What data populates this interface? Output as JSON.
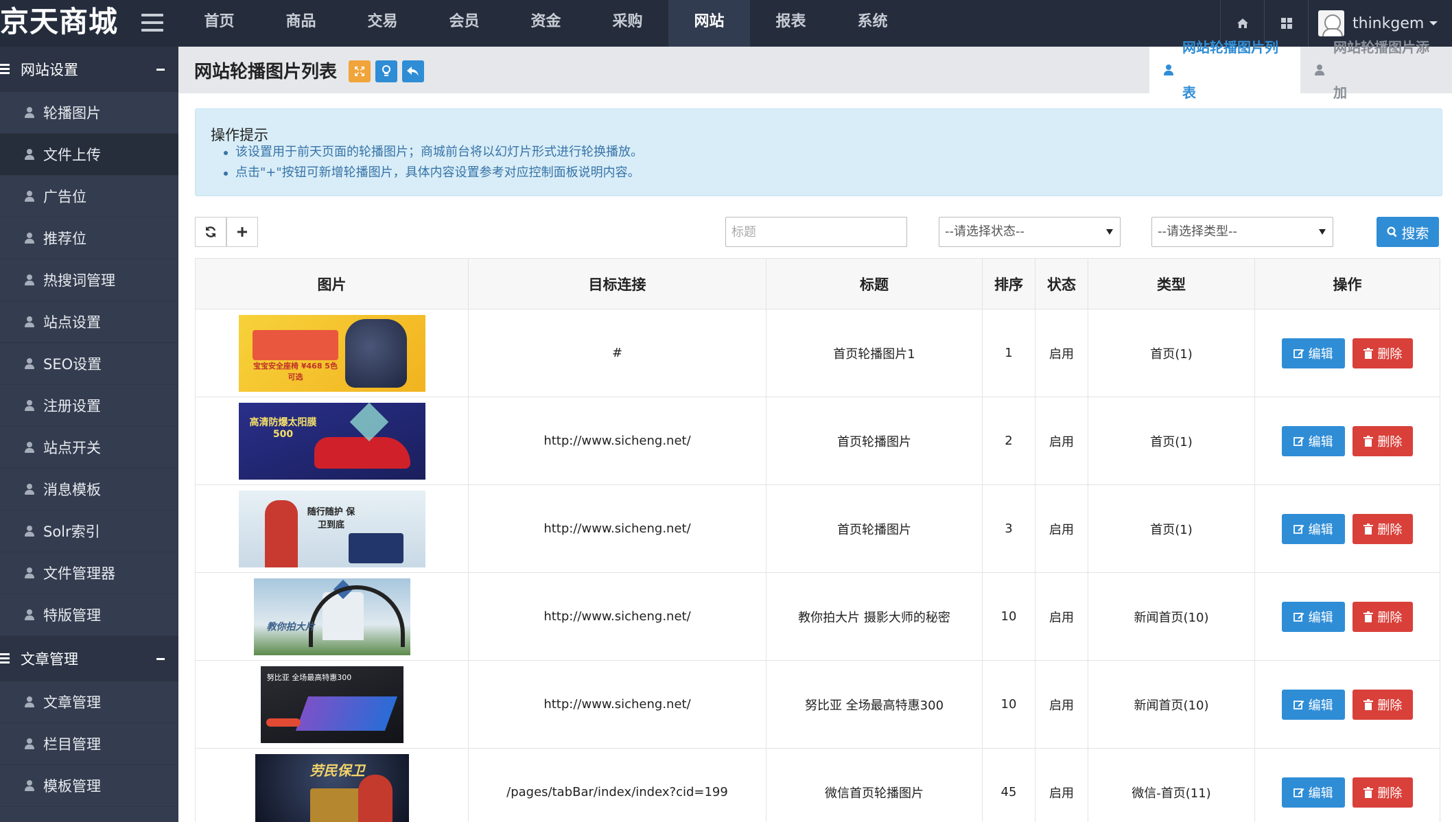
{
  "brand": "京天商城",
  "nav": [
    "首页",
    "商品",
    "交易",
    "会员",
    "资金",
    "采购",
    "网站",
    "报表",
    "系统"
  ],
  "nav_active_index": 6,
  "user": {
    "name": "thinkgem"
  },
  "sidebar": {
    "groups": [
      {
        "title": "网站设置",
        "items": [
          "轮播图片",
          "文件上传",
          "广告位",
          "推荐位",
          "热搜词管理",
          "站点设置",
          "SEO设置",
          "注册设置",
          "站点开关",
          "消息模板",
          "Solr索引",
          "文件管理器",
          "特版管理"
        ]
      },
      {
        "title": "文章管理",
        "items": [
          "文章管理",
          "栏目管理",
          "模板管理"
        ]
      }
    ],
    "active_item": "文件上传"
  },
  "page": {
    "title": "网站轮播图片列表",
    "tabs": [
      "网站轮播图片列表",
      "网站轮播图片添加"
    ]
  },
  "tips": {
    "title": "操作提示",
    "lines": [
      "该设置用于前天页面的轮播图片；商城前台将以幻灯片形式进行轮换播放。",
      "点击\"+\"按钮可新增轮播图片，具体内容设置参考对应控制面板说明内容。"
    ]
  },
  "filters": {
    "title_placeholder": "标题",
    "status_select": "--请选择状态--",
    "type_select": "--请选择类型--",
    "search_label": "搜索"
  },
  "table": {
    "headers": [
      "图片",
      "目标连接",
      "标题",
      "排序",
      "状态",
      "类型",
      "操作"
    ],
    "edit_label": "编辑",
    "delete_label": "删除",
    "rows": [
      {
        "link": "#",
        "title": "首页轮播图片1",
        "sort": "1",
        "status": "启用",
        "type": "首页(1)",
        "thumb_text": "宝宝安全座椅 ¥468 5色可选"
      },
      {
        "link": "http://www.sicheng.net/",
        "title": "首页轮播图片",
        "sort": "2",
        "status": "启用",
        "type": "首页(1)",
        "thumb_text": "高清防爆太阳膜 500"
      },
      {
        "link": "http://www.sicheng.net/",
        "title": "首页轮播图片",
        "sort": "3",
        "status": "启用",
        "type": "首页(1)",
        "thumb_text": "随行随护 保卫到底"
      },
      {
        "link": "http://www.sicheng.net/",
        "title": "教你拍大片 摄影大师的秘密",
        "sort": "10",
        "status": "启用",
        "type": "新闻首页(10)",
        "thumb_text": "教你拍大片"
      },
      {
        "link": "http://www.sicheng.net/",
        "title": "努比亚 全场最高特惠300",
        "sort": "10",
        "status": "启用",
        "type": "新闻首页(10)",
        "thumb_text": "努比亚 全场最高特惠300"
      },
      {
        "link": "/pages/tabBar/index/index?cid=199",
        "title": "微信首页轮播图片",
        "sort": "45",
        "status": "启用",
        "type": "微信-首页(11)",
        "thumb_text": "劳民保卫"
      }
    ]
  },
  "colors": {
    "topbar": "#252d3d",
    "sidebar": "#343d4f",
    "primary": "#2f8dd6",
    "danger": "#d9403a",
    "tips_bg": "#d8edf7"
  }
}
